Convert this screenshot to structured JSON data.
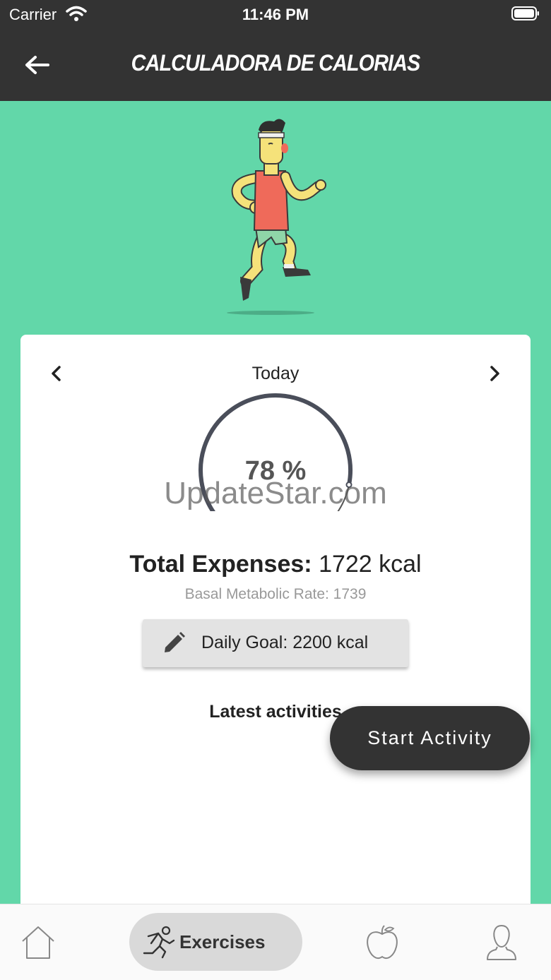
{
  "status_bar": {
    "carrier": "Carrier",
    "time": "11:46 PM",
    "icons": [
      "wifi-icon",
      "battery-icon"
    ]
  },
  "header": {
    "title": "CALCULADORA DE CALORIAS",
    "back_icon": "arrow-left-icon"
  },
  "hero": {
    "illustration": "running-man-illustration"
  },
  "card": {
    "day_label": "Today",
    "prev_icon": "chevron-left-icon",
    "next_icon": "chevron-right-icon",
    "progress": {
      "value_label": "78 %",
      "fraction": 0.78
    },
    "watermark": "UpdateStar.com",
    "total_label": "Total Expenses:",
    "total_value": "1722 kcal",
    "bmr_label": "Basal Metabolic Rate: 1739",
    "goal_button": {
      "icon": "pencil-icon",
      "label": "Daily Goal: 2200 kcal"
    },
    "latest_title": "Latest activities"
  },
  "fab": {
    "label": "Start Activity"
  },
  "bottom_nav": {
    "items": [
      {
        "icon": "home-icon",
        "label": ""
      },
      {
        "icon": "running-icon",
        "label": "Exercises",
        "active": true
      },
      {
        "icon": "apple-icon",
        "label": ""
      },
      {
        "icon": "person-icon",
        "label": ""
      }
    ]
  },
  "colors": {
    "background": "#62d7a9",
    "bar": "#333333",
    "card": "#ffffff",
    "active_tab": "#d9d9d9"
  }
}
